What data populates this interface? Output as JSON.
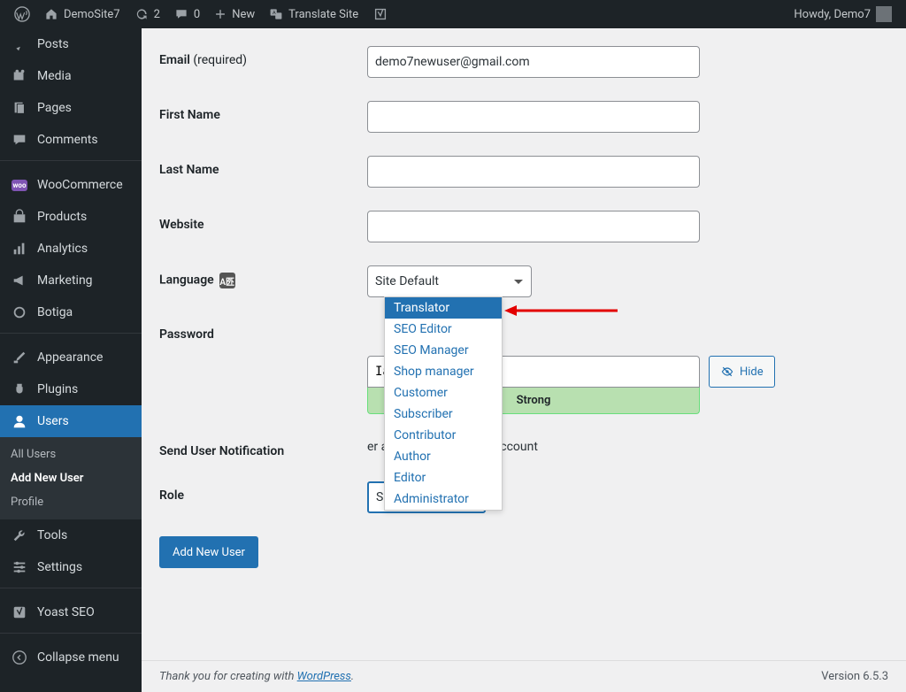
{
  "adminbar": {
    "site_name": "DemoSite7",
    "updates": "2",
    "comments": "0",
    "new": "New",
    "translate": "Translate Site",
    "howdy": "Howdy, Demo7"
  },
  "sidebar": {
    "items": [
      {
        "label": "Posts"
      },
      {
        "label": "Media"
      },
      {
        "label": "Pages"
      },
      {
        "label": "Comments"
      },
      {
        "label": "WooCommerce"
      },
      {
        "label": "Products"
      },
      {
        "label": "Analytics"
      },
      {
        "label": "Marketing"
      },
      {
        "label": "Botiga"
      },
      {
        "label": "Appearance"
      },
      {
        "label": "Plugins"
      },
      {
        "label": "Users"
      },
      {
        "label": "Tools"
      },
      {
        "label": "Settings"
      },
      {
        "label": "Yoast SEO"
      },
      {
        "label": "Collapse menu"
      }
    ],
    "submenu": [
      {
        "label": "All Users"
      },
      {
        "label": "Add New User"
      },
      {
        "label": "Profile"
      }
    ]
  },
  "form": {
    "email_label": "Email",
    "required": " (required)",
    "email_value": "demo7newuser@gmail.com",
    "first_name_label": "First Name",
    "last_name_label": "Last Name",
    "website_label": "Website",
    "language_label": "Language",
    "language_value": "Site Default",
    "password_label": "Password",
    "password_value": "Iamb9(rluK",
    "strength": "Strong",
    "hide": "Hide",
    "notif_label": "Send User Notification",
    "notif_text": "er an email about their account",
    "role_label": "Role",
    "role_value": "Subscriber",
    "submit": "Add New User"
  },
  "dropdown": {
    "options": [
      "Translator",
      "SEO Editor",
      "SEO Manager",
      "Shop manager",
      "Customer",
      "Subscriber",
      "Contributor",
      "Author",
      "Editor",
      "Administrator"
    ]
  },
  "footer": {
    "thanks": "Thank you for creating with ",
    "wp": "WordPress",
    "period": ".",
    "version": "Version 6.5.3"
  }
}
